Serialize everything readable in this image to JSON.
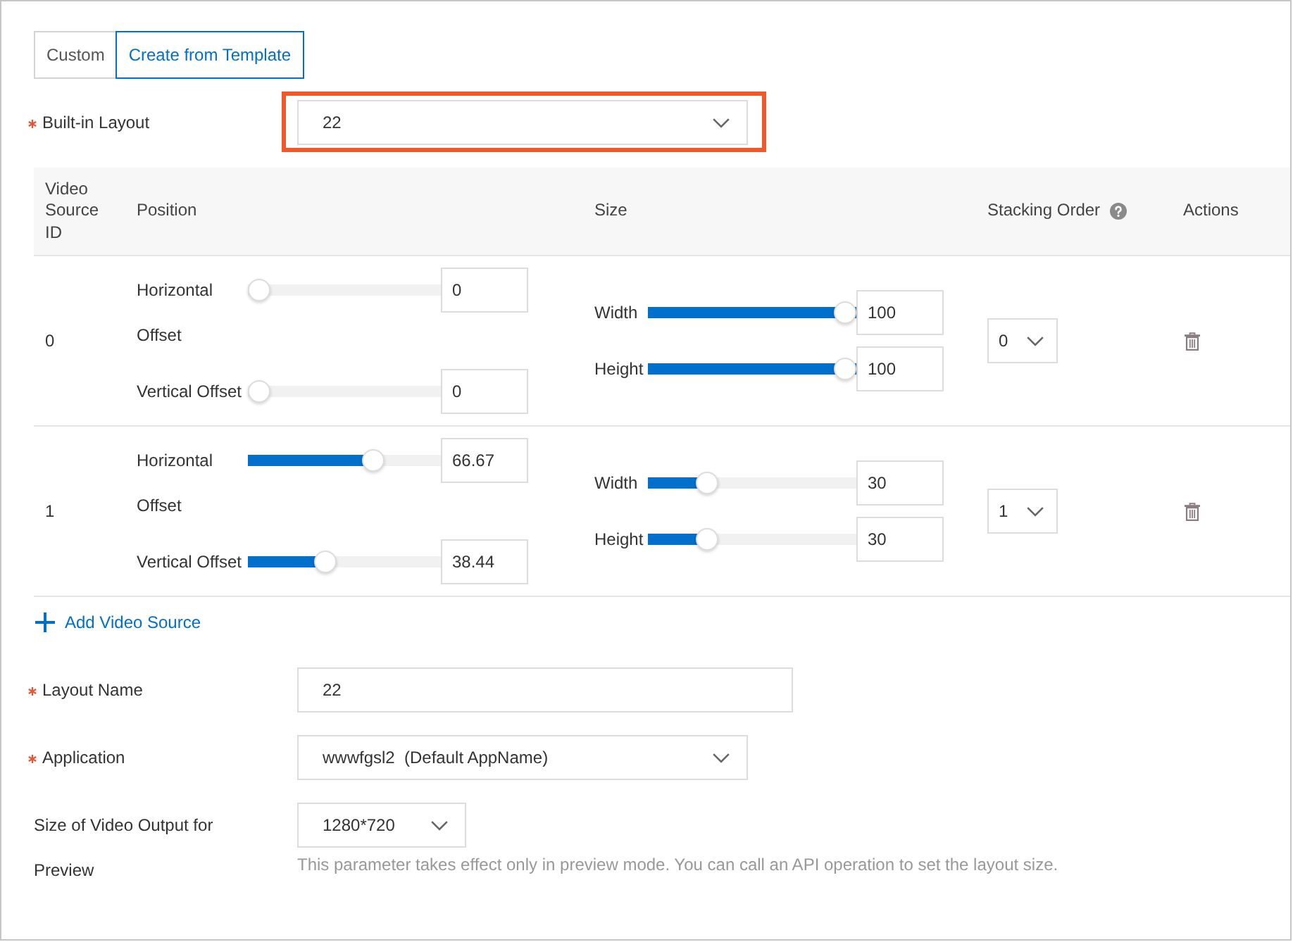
{
  "tabs": [
    {
      "label": "Custom",
      "selected": false
    },
    {
      "label": "Create from Template",
      "selected": true
    }
  ],
  "built_in_layout": {
    "kind": "select",
    "label": "Built-in Layout",
    "required": true,
    "value": "22",
    "highlighted": true
  },
  "table": {
    "columns": [
      {
        "label": "Video Source ID"
      },
      {
        "label": "Position"
      },
      {
        "label": "Size"
      },
      {
        "label": "Stacking Order",
        "help": true
      },
      {
        "label": "Actions"
      }
    ],
    "rows": [
      {
        "id": "0",
        "position": [
          {
            "label": "Horizontal Offset",
            "level": 0,
            "value": "0"
          },
          {
            "label": "Vertical Offset",
            "level": 0,
            "value": "0"
          }
        ],
        "size": [
          {
            "label": "Width",
            "level": 1,
            "value": "100"
          },
          {
            "label": "Height",
            "level": 1,
            "value": "100"
          }
        ],
        "stacking_order": "0"
      },
      {
        "id": "1",
        "position": [
          {
            "label": "Horizontal Offset",
            "level": 0.6667,
            "value": "66.67"
          },
          {
            "label": "Vertical Offset",
            "level": 0.3844,
            "value": "38.44"
          }
        ],
        "size": [
          {
            "label": "Width",
            "level": 0.26,
            "value": "30"
          },
          {
            "label": "Height",
            "level": 0.26,
            "value": "30"
          }
        ],
        "stacking_order": "1"
      }
    ]
  },
  "add_video_source": {
    "label": "Add Video Source"
  },
  "fields": [
    {
      "kind": "input",
      "label": "Layout Name",
      "required": true,
      "value": "22"
    },
    {
      "kind": "select",
      "label": "Application",
      "required": true,
      "value": "wwwfgsl2  (Default AppName)"
    },
    {
      "kind": "select",
      "label": "Size of Video Output for Preview",
      "value": "1280*720",
      "help_text": "This parameter takes effect only in preview mode. You can call an API operation to set the layout size."
    }
  ]
}
